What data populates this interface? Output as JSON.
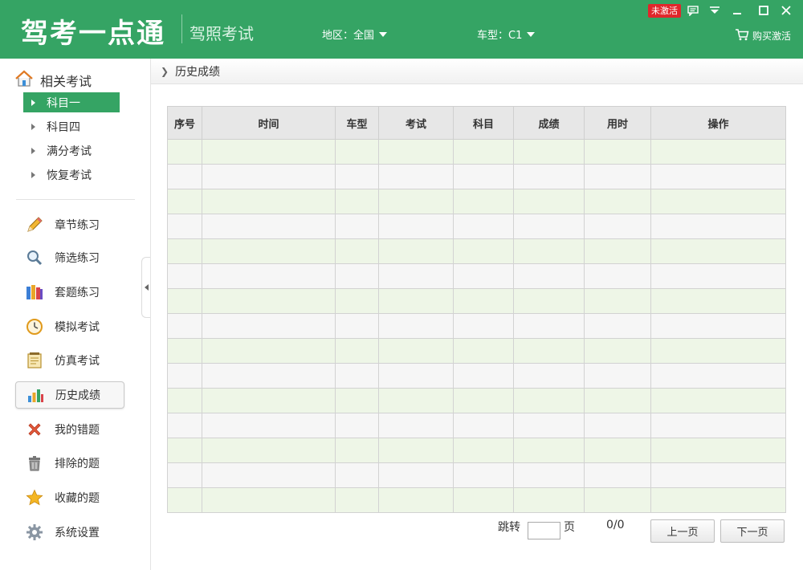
{
  "header": {
    "logo": "驾考一点通",
    "subtitle": "驾照考试",
    "region_label": "地区：全国",
    "cartype_label": "车型：C1",
    "badge": "未激活",
    "buy_label": "购买激活",
    "brand_color": "#35a464"
  },
  "sidebar": {
    "related_title": "相关考试",
    "sub_items": [
      {
        "label": "科目一",
        "active": true
      },
      {
        "label": "科目四",
        "active": false
      },
      {
        "label": "满分考试",
        "active": false
      },
      {
        "label": "恢复考试",
        "active": false
      }
    ],
    "nav_items": [
      {
        "label": "章节练习",
        "icon": "pencil-icon",
        "active": false
      },
      {
        "label": "筛选练习",
        "icon": "magnifier-icon",
        "active": false
      },
      {
        "label": "套题练习",
        "icon": "books-icon",
        "active": false
      },
      {
        "label": "模拟考试",
        "icon": "clock-icon",
        "active": false
      },
      {
        "label": "仿真考试",
        "icon": "notepad-icon",
        "active": false
      },
      {
        "label": "历史成绩",
        "icon": "bar-chart-icon",
        "active": true
      },
      {
        "label": "我的错题",
        "icon": "red-x-icon",
        "active": false
      },
      {
        "label": "排除的题",
        "icon": "trash-icon",
        "active": false
      },
      {
        "label": "收藏的题",
        "icon": "star-icon",
        "active": false
      },
      {
        "label": "系统设置",
        "icon": "gear-icon",
        "active": false
      }
    ]
  },
  "main": {
    "breadcrumb": "历史成绩",
    "table": {
      "columns": [
        "序号",
        "时间",
        "车型",
        "考试",
        "科目",
        "成绩",
        "用时",
        "操作"
      ],
      "row_count": 15
    },
    "pager": {
      "jump_label": "跳转",
      "page_unit": "页",
      "page_status": "0/0",
      "prev_label": "上一页",
      "next_label": "下一页"
    }
  }
}
